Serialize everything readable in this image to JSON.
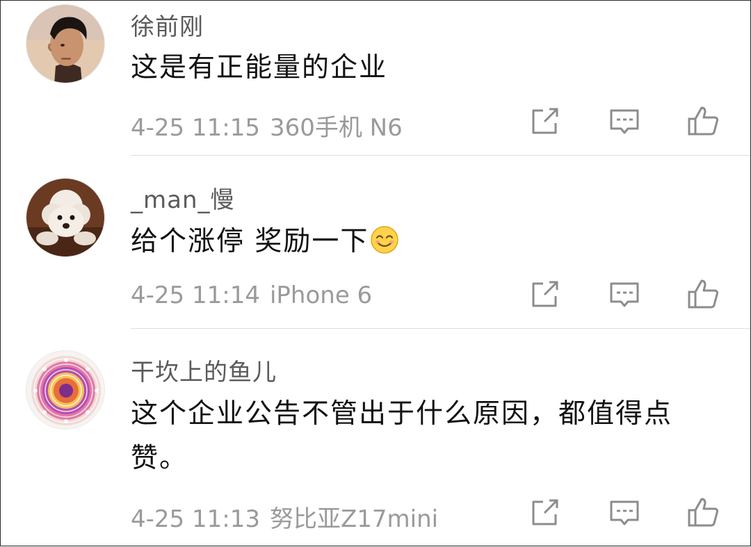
{
  "comments": [
    {
      "username": "徐前刚",
      "text": "这是有正能量的企业",
      "time": "4-25 11:15",
      "device": "360手机 N6",
      "avatar": "man-profile-avatar"
    },
    {
      "username": "_man_慢",
      "text": "给个涨停 奖励一下",
      "emoji": "smile-emoji",
      "time": "4-25 11:14",
      "device": "iPhone 6",
      "avatar": "white-poodle-avatar"
    },
    {
      "username": "干坎上的鱼儿",
      "text": "这个企业公告不管出于什么原因，都值得点赞。",
      "time": "4-25 11:13",
      "device": "努比亚Z17mini",
      "avatar": "mandala-avatar"
    }
  ],
  "icons": {
    "repost": "repost-icon",
    "comment": "comment-icon",
    "like": "like-icon"
  },
  "colors": {
    "username": "#5a5a5a",
    "content": "#111111",
    "meta": "#9a9a9a",
    "icon": "#8c8c8c",
    "divider": "#dedede"
  }
}
